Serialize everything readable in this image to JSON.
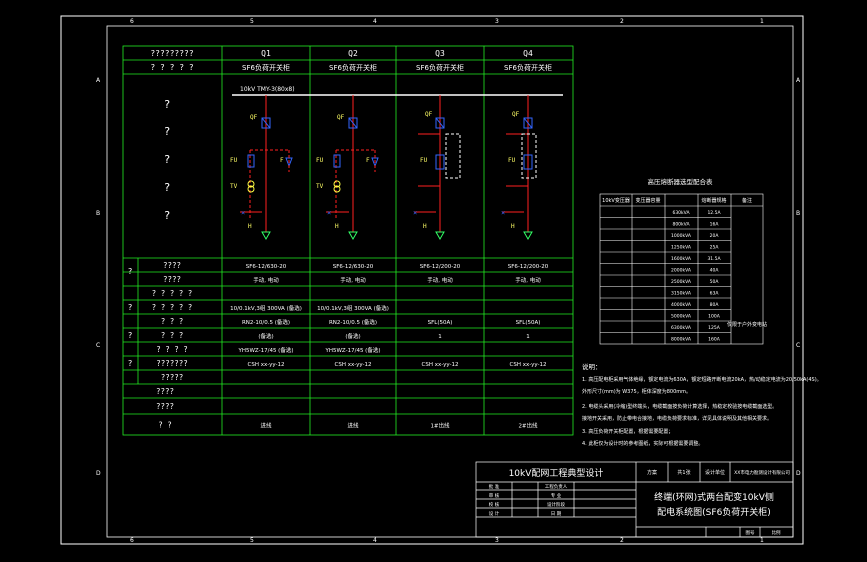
{
  "frame": {
    "zone_numbers_top": [
      "1",
      "2",
      "3",
      "4",
      "5",
      "6"
    ],
    "zone_letters_left": [
      "A",
      "B",
      "C",
      "D"
    ]
  },
  "main_table": {
    "header_row1": [
      "?????????",
      "Q1",
      "Q2",
      "Q3",
      "Q4"
    ],
    "header_row2": [
      "? ? ? ? ?",
      "SF6负荷开关柜",
      "SF6负荷开关柜",
      "SF6负荷开关柜",
      "SF6负荷开关柜"
    ],
    "bus_label": "10kV  TMY-3(80x8)",
    "diagram_left_marks": [
      "?",
      "?",
      "?",
      "?",
      "?"
    ],
    "symbol_labels": {
      "QF": "QF",
      "FU": "FU",
      "TV": "TV",
      "F": "F",
      "H": "H"
    },
    "side_marks": [
      "?",
      "?",
      "?",
      "?"
    ],
    "rows": [
      {
        "label": "????",
        "cells": [
          "SF6-12/630-20",
          "SF6-12/630-20",
          "SF6-12/200-20",
          "SF6-12/200-20"
        ]
      },
      {
        "label": "????",
        "cells": [
          "手动, 电动",
          "手动, 电动",
          "手动, 电动",
          "手动, 电动"
        ]
      },
      {
        "label": "? ? ? ? ?",
        "cells": [
          "",
          "",
          "",
          ""
        ]
      },
      {
        "label": "? ? ? ? ?",
        "cells": [
          "10/0.1kV,3组 300VA (备选)",
          "10/0.1kV,3组 300VA (备选)",
          "",
          ""
        ]
      },
      {
        "label": "? ? ?",
        "cells": [
          "RN2-10/0.5 (备选)",
          "RN2-10/0.5 (备选)",
          "SFL(50A)",
          "SFL(50A)"
        ]
      },
      {
        "label": "? ? ?",
        "cells": [
          "(备选)",
          "(备选)",
          "1",
          "1"
        ]
      },
      {
        "label": "? ? ? ?",
        "cells": [
          "YH5WZ-17/45 (备选)",
          "YH5WZ-17/45 (备选)",
          "",
          ""
        ]
      },
      {
        "label": "???????",
        "cells": [
          "CSH  xx-yy-12",
          "CSH  xx-yy-12",
          "CSH  xx-yy-12",
          "CSH  xx-yy-12"
        ]
      },
      {
        "label": "?????",
        "cells": [
          "",
          "",
          "",
          ""
        ]
      },
      {
        "label": "????",
        "cells": [
          "",
          "",
          "",
          ""
        ]
      },
      {
        "label": "????",
        "cells": [
          "",
          "",
          "",
          ""
        ]
      },
      {
        "label": "? ?",
        "cells": [
          "进线",
          "进线",
          "1#出线",
          "2#出线"
        ]
      }
    ]
  },
  "right_table": {
    "title": "高压熔断器选型配合表",
    "headers": [
      "10kV变压器",
      "变压器容量",
      "熔断器规格",
      "备注"
    ],
    "rows": [
      [
        "",
        "",
        "630kVA",
        ""
      ],
      [
        "",
        "",
        "800kVA",
        ""
      ],
      [
        "",
        "",
        "1000kVA",
        ""
      ],
      [
        "",
        "",
        "1250kVA",
        ""
      ],
      [
        "",
        "",
        "1600kVA",
        ""
      ],
      [
        "",
        "",
        "2000kVA",
        ""
      ],
      [
        "",
        "",
        "2500kVA",
        ""
      ],
      [
        "",
        "",
        "3150kVA",
        ""
      ],
      [
        "",
        "",
        "4000kVA",
        ""
      ],
      [
        "",
        "",
        "5000kVA",
        ""
      ],
      [
        "",
        "",
        "6300kVA",
        ""
      ],
      [
        "",
        "",
        "8000kVA",
        ""
      ]
    ],
    "col2_values": [
      "12.5A",
      "16A",
      "20A",
      "25A",
      "31.5A",
      "40A",
      "50A",
      "63A",
      "80A",
      "100A",
      "125A",
      "160A"
    ],
    "remark": "仅限于户外变电站"
  },
  "notes": {
    "title": "说明：",
    "lines": [
      "1. 高压配电柜采用气体绝缘，额定电流为630A，额定短路开断电流20kA，热/动稳定电流为20/50kA(4S)。",
      "   外形尺寸(mm)为 W375，柜体深度为800mm。",
      "2. 电缆头采用(冷缩)型终端头，电缆截面按负荷计算选择，热稳定校验按电缆截面选型。",
      "   接地开关采用，防止带电合接地，电缆负荷要求标准，详见具体说明及其他相关要求。",
      "3. 高压负荷开关柜配置，根据需要配置；",
      "4. 此柜仅为设计时的参考图纸，实际可根据需要调整。"
    ]
  },
  "title_block": {
    "left_title": "10kV配网工程典型设计",
    "scheme_label": "方案",
    "scheme_value": "",
    "page_label": "共1张",
    "design_org_label": "设计单位",
    "design_org": "XX市电力勘测设计有限公司",
    "roles": [
      "批 准",
      "审 核",
      "校 核",
      "设 计"
    ],
    "role_labels_right": [
      "工程负责人",
      "专 业",
      "设计阶段",
      "日 期"
    ],
    "drawing_title_line1": "终端(环网)式两台配变10kV侧",
    "drawing_title_line2": "配电系统图(SF6负荷开关柜)",
    "drawing_number": "",
    "sheet_label": "图号",
    "scale_label": "比例"
  },
  "colors": {
    "background": "#000000",
    "table_lines": "#22ee22",
    "frame": "#ffffff",
    "bus": "#ffffff",
    "circuit_red": "#ff2020",
    "circuit_blue": "#3366ff",
    "circuit_yellow": "#ffff44",
    "circuit_green": "#33ff66"
  }
}
